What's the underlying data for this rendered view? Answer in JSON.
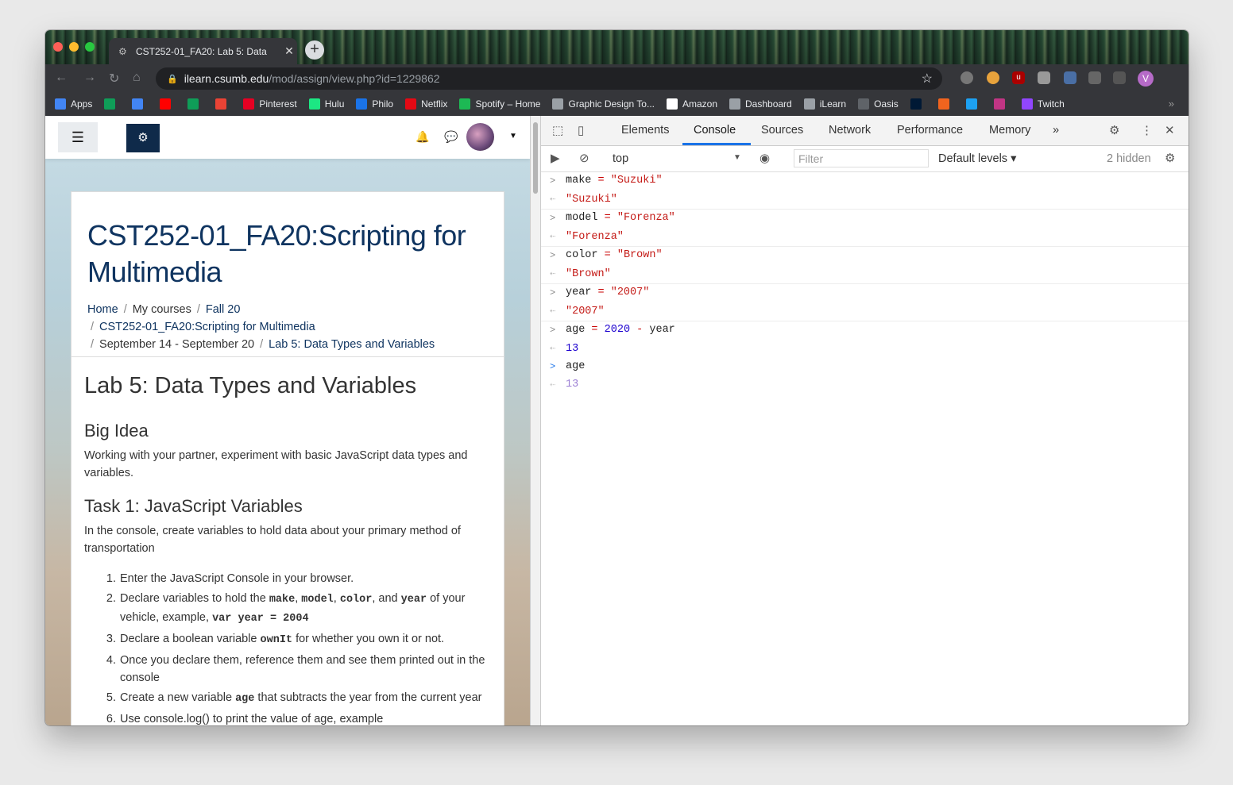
{
  "tab": {
    "title": "CST252-01_FA20: Lab 5: Data"
  },
  "address": {
    "host": "ilearn.csumb.edu",
    "path": "/mod/assign/view.php?id=1229862"
  },
  "profile_initial": "V",
  "bookmarks": [
    {
      "label": "Apps",
      "icon": "apps-grid-icon",
      "color": "#4285f4"
    },
    {
      "label": "",
      "icon": "drive-icon",
      "color": "#0f9d58"
    },
    {
      "label": "",
      "icon": "docs-icon",
      "color": "#4285f4"
    },
    {
      "label": "",
      "icon": "youtube-icon",
      "color": "#ff0000"
    },
    {
      "label": "",
      "icon": "sheets-plus-icon",
      "color": "#0f9d58"
    },
    {
      "label": "",
      "icon": "gmail-icon",
      "color": "#ea4335"
    },
    {
      "label": "Pinterest",
      "icon": "pinterest-icon",
      "color": "#e60023"
    },
    {
      "label": "Hulu",
      "icon": "hulu-icon",
      "color": "#1ce783"
    },
    {
      "label": "Philo",
      "icon": "philo-icon",
      "color": "#1a73e8"
    },
    {
      "label": "Netflix",
      "icon": "netflix-icon",
      "color": "#e50914"
    },
    {
      "label": "Spotify – Home",
      "icon": "spotify-icon",
      "color": "#1db954"
    },
    {
      "label": "Graphic Design To...",
      "icon": "folder-icon",
      "color": "#9aa0a6"
    },
    {
      "label": "Amazon",
      "icon": "amazon-icon",
      "color": "#ffffff"
    },
    {
      "label": "Dashboard",
      "icon": "moodle-icon",
      "color": "#9aa0a6"
    },
    {
      "label": "iLearn",
      "icon": "moodle-icon",
      "color": "#9aa0a6"
    },
    {
      "label": "Oasis",
      "icon": "oasis-icon",
      "color": "#5f6368"
    },
    {
      "label": "",
      "icon": "tumblr-icon",
      "color": "#001935"
    },
    {
      "label": "",
      "icon": "etsy-icon",
      "color": "#f1641e"
    },
    {
      "label": "",
      "icon": "twitter-icon",
      "color": "#1da1f2"
    },
    {
      "label": "",
      "icon": "instagram-icon",
      "color": "#c13584"
    },
    {
      "label": "Twitch",
      "icon": "twitch-icon",
      "color": "#9146ff"
    }
  ],
  "bookmarks_more": "»",
  "page": {
    "course_title": "CST252-01_FA20:Scripting for Multimedia",
    "breadcrumb": {
      "home": "Home",
      "my_courses": "My courses",
      "term": "Fall 20",
      "course": "CST252-01_FA20:Scripting for Multimedia",
      "week": "September 14 - September 20",
      "assignment": "Lab 5: Data Types and Variables",
      "sep": "/"
    },
    "lab_title": "Lab 5: Data Types and Variables",
    "big_idea_heading": "Big Idea",
    "big_idea_text": "Working with your partner, experiment with basic JavaScript data types and variables.",
    "task1_heading": "Task 1: JavaScript Variables",
    "task1_text": "In the console, create variables to hold data about your primary method of transportation",
    "steps": {
      "s1": {
        "num": "1.",
        "text": "Enter the JavaScript Console in your browser."
      },
      "s2": {
        "num": "2.",
        "a": "Declare variables to hold the ",
        "make": "make",
        "c1": ", ",
        "model": "model",
        "c2": ", ",
        "color": "color",
        "c3": ", and ",
        "year": "year",
        "b": " of your vehicle, example, ",
        "code": "var year = 2004"
      },
      "s3": {
        "num": "3.",
        "a": "Declare a boolean variable ",
        "code": "ownIt",
        "b": " for whether you own it or not."
      },
      "s4": {
        "num": "4.",
        "text": "Once you declare them, reference them and see them printed out in the console"
      },
      "s5": {
        "num": "5.",
        "a": "Create a new variable ",
        "code": "age",
        "b": " that subtracts the year from the current year"
      },
      "s6": {
        "num": "6.",
        "text": "Use console.log() to print the value of age, example"
      }
    }
  },
  "devtools": {
    "tabs": [
      "Elements",
      "Console",
      "Sources",
      "Network",
      "Performance",
      "Memory"
    ],
    "more_tabs": "»",
    "context": "top",
    "filter_placeholder": "Filter",
    "levels": "Default levels ▾",
    "hidden_count": "2 hidden",
    "console": {
      "l1": {
        "name": "make",
        "eq": "=",
        "val": "\"Suzuki\"",
        "result": "\"Suzuki\""
      },
      "l2": {
        "name": "model",
        "eq": "=",
        "val": "\"Forenza\"",
        "result": "\"Forenza\""
      },
      "l3": {
        "name": "color",
        "eq": "=",
        "val": "\"Brown\"",
        "result": "\"Brown\""
      },
      "l4": {
        "name": "year",
        "eq": "=",
        "val": "\"2007\"",
        "result": "\"2007\""
      },
      "l5": {
        "name": "age",
        "eq": "=",
        "num": "2020",
        "minus": "-",
        "ref": "year",
        "result": "13"
      },
      "l6": {
        "input": "age",
        "preview": "13"
      }
    }
  }
}
